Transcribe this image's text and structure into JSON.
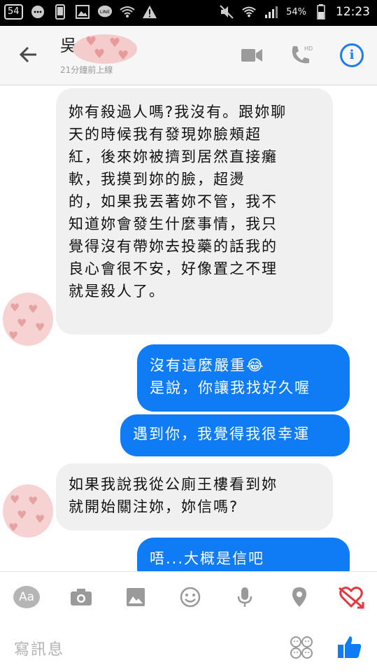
{
  "status_bar": {
    "notif_count": "54",
    "battery": "54%",
    "time": "12:23"
  },
  "header": {
    "contact_name": "吳",
    "last_active": "21分鐘前上線"
  },
  "messages": [
    {
      "side": "incoming",
      "text": "妳有殺過人嗎?我沒有。跟妳聊\n天的時候我有發現妳臉頰超\n紅，後來妳被擠到居然直接癱\n軟，我摸到妳的臉，超燙\n的，如果我丟著妳不管，我不\n知道妳會發生什麼事情，我只\n覺得沒有帶妳去投藥的話我的\n良心會很不安，好像置之不理\n就是殺人了。"
    },
    {
      "side": "outgoing",
      "text": "沒有這麼嚴重😂\n是說，你讓我找好久喔"
    },
    {
      "side": "outgoing",
      "text": "遇到你，我覺得我很幸運"
    },
    {
      "side": "incoming",
      "text": "如果我說我從公廁王樓看到妳\n就開始關注妳，妳信嗎?"
    },
    {
      "side": "outgoing",
      "text": "唔...大概是信吧"
    }
  ],
  "composer": {
    "aa_label": "Aa",
    "placeholder": "寫訊息"
  },
  "icons": {
    "status_left": [
      "notification-count-icon",
      "line-chat-icon",
      "phone-device-icon",
      "image-icon",
      "line-app-icon",
      "wifi-icon",
      "warning-icon"
    ],
    "status_right": [
      "mute-icon",
      "wifi-signal-icon",
      "cell-signal-icon"
    ],
    "header": [
      "back-arrow-icon",
      "video-call-icon",
      "hd-phone-icon",
      "info-icon"
    ],
    "toolbar": [
      "aa-text-icon",
      "camera-icon",
      "gallery-icon",
      "emoji-icon",
      "microphone-icon",
      "location-icon",
      "heart-arrow-icon"
    ],
    "compose": [
      "sticker-icon",
      "thumbs-up-icon"
    ]
  },
  "colors": {
    "outgoing_bubble": "#0f7cf5",
    "incoming_bubble": "#f1f0f0",
    "accent": "#1d7cf2"
  }
}
